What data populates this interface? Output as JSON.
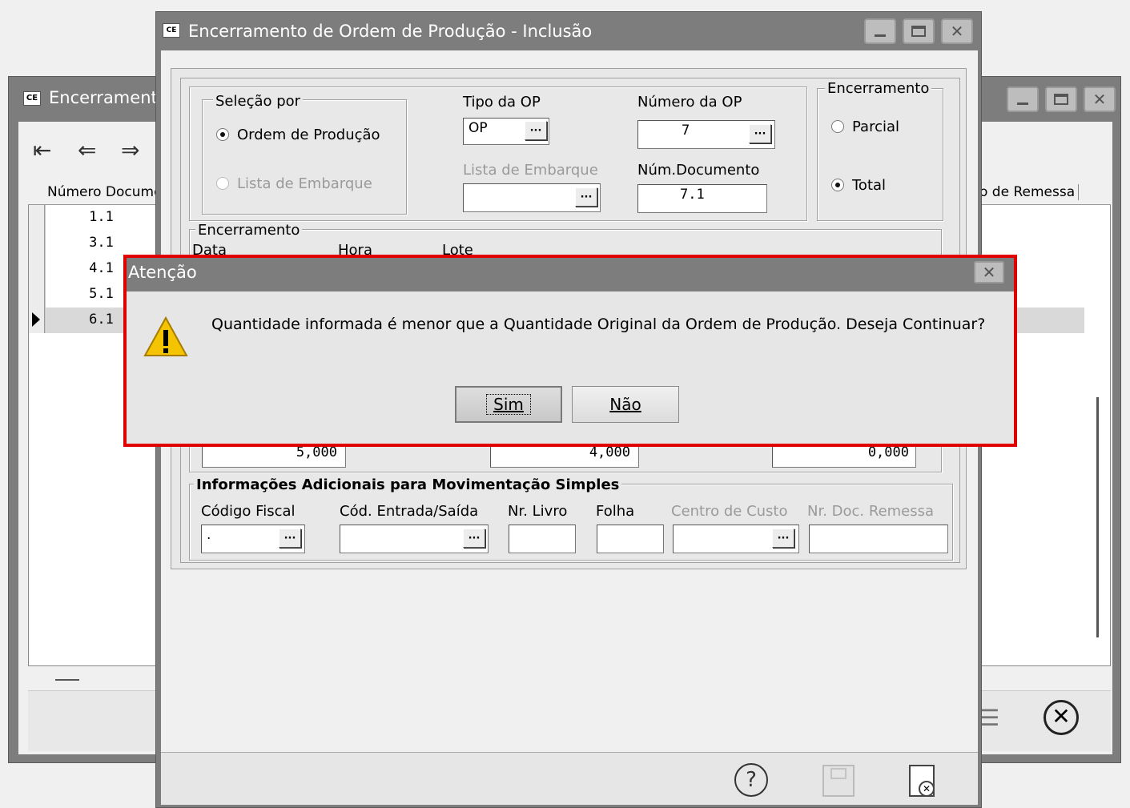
{
  "back_window": {
    "title": "Encerrament",
    "nav_icons": [
      "first-icon",
      "prev-icon",
      "next-icon"
    ],
    "grid": {
      "col_header": "Número Docume",
      "col_header_right": "o de Remessa",
      "rows": [
        "1.1",
        "3.1",
        "4.1",
        "5.1",
        "6.1"
      ],
      "selected_index": 4
    }
  },
  "main_window": {
    "logo": "CE",
    "title": "Encerramento de Ordem de Produção - Inclusão",
    "selecao": {
      "group_title": "Seleção por",
      "opt_ordem": "Ordem de Produção",
      "opt_lista": "Lista de Embarque"
    },
    "tipo_op": {
      "label": "Tipo da OP",
      "value": "OP"
    },
    "numero_op": {
      "label": "Número da OP",
      "value": "7"
    },
    "lista_embarque": {
      "label": "Lista de Embarque",
      "value": ""
    },
    "num_documento": {
      "label": "Núm.Documento",
      "value": "7.1"
    },
    "encerramento_tipo": {
      "group_title": "Encerramento",
      "opt_parcial": "Parcial",
      "opt_total": "Total",
      "selected": "Total"
    },
    "encerramento_group": {
      "title": "Encerramento",
      "col_data": "Data",
      "col_hora": "Hora",
      "col_lote": "Lote"
    },
    "quantities": [
      "5,000",
      "4,000",
      "0,000"
    ],
    "info_adicionais": {
      "title": "Informações Adicionais para Movimentação Simples",
      "codigo_fiscal": {
        "label": "Código Fiscal",
        "value": "."
      },
      "cod_entrada_saida": {
        "label": "Cód. Entrada/Saída",
        "value": ""
      },
      "nr_livro": {
        "label": "Nr. Livro",
        "value": ""
      },
      "folha": {
        "label": "Folha",
        "value": ""
      },
      "centro_custo": {
        "label": "Centro de Custo",
        "value": ""
      },
      "nr_doc_remessa": {
        "label": "Nr. Doc. Remessa",
        "value": ""
      }
    }
  },
  "dialog": {
    "title": "Atenção",
    "message": "Quantidade informada é menor que a Quantidade Original da Ordem de Produção. Deseja Continuar?",
    "yes_label": "Sim",
    "no_label": "Não"
  },
  "colors": {
    "title_bar": "#7d7d7d",
    "dialog_highlight": "#e00000",
    "warning_yellow": "#f5c400"
  }
}
